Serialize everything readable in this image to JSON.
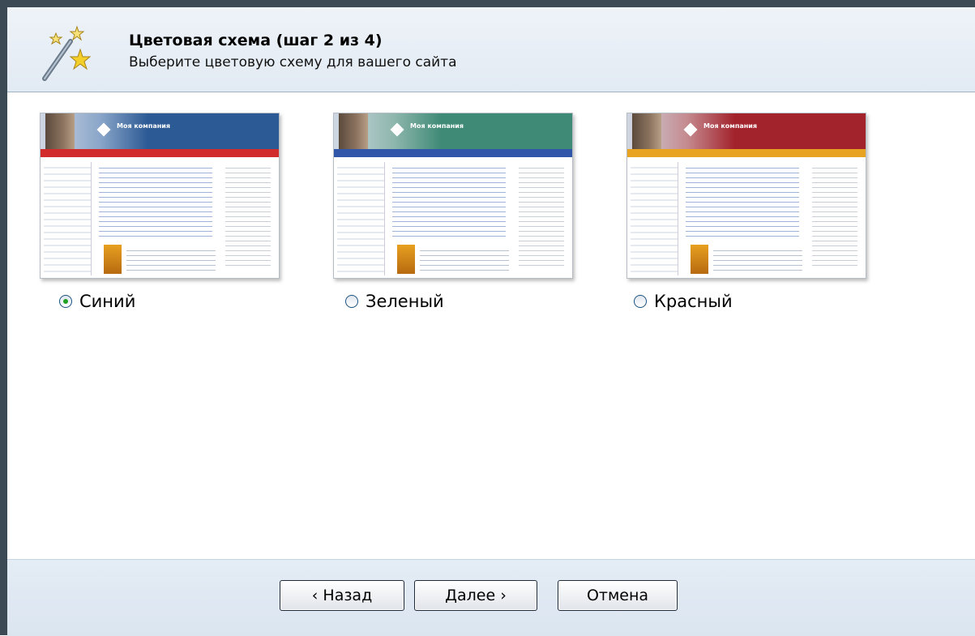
{
  "header": {
    "title": "Цветовая схема (шаг 2 из 4)",
    "subtitle": "Выберите цветовую схему для вашего сайта",
    "icon": "magic-wand-icon"
  },
  "schemes": [
    {
      "label": "Синий",
      "selected": true,
      "banner_color": "#2c5a95",
      "menu_color": "#d22b2b"
    },
    {
      "label": "Зеленый",
      "selected": false,
      "banner_color": "#3f8a76",
      "menu_color": "#2f56a8"
    },
    {
      "label": "Красный",
      "selected": false,
      "banner_color": "#a3232d",
      "menu_color": "#e8a321"
    }
  ],
  "thumbnail": {
    "company_name": "Моя компания"
  },
  "buttons": {
    "back": "‹ Назад",
    "next": "Далее ›",
    "cancel": "Отмена"
  },
  "colors": {
    "frame": "#3c4a56",
    "header_bg": "#e2eaf3",
    "selected_radio": "#21a121"
  }
}
